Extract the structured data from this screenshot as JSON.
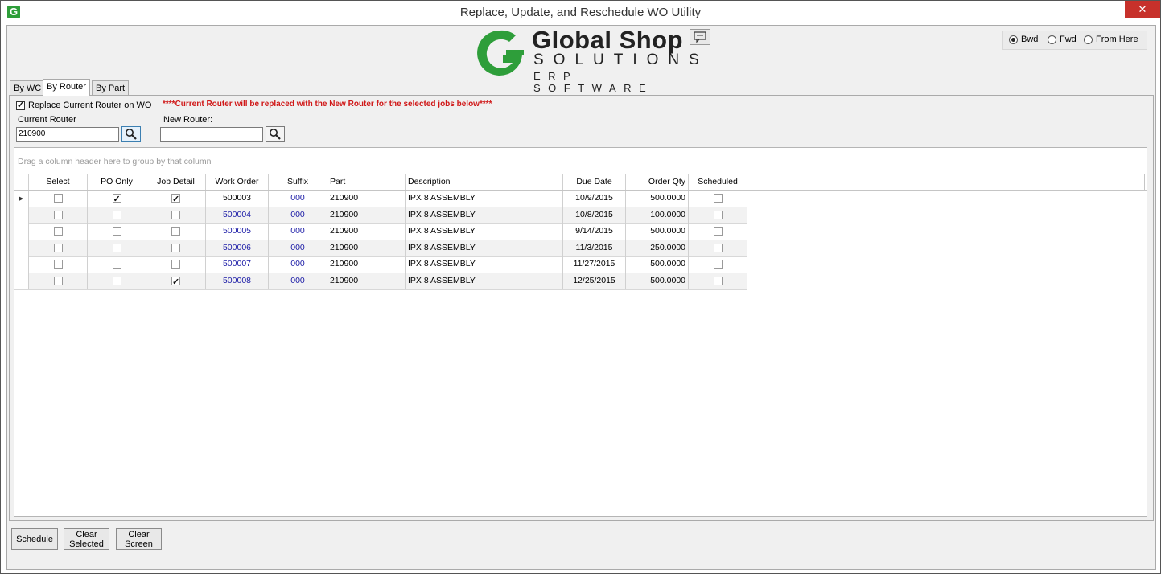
{
  "window": {
    "title": "Replace, Update, and Reschedule WO Utility",
    "minimize": "—",
    "maximize": "▢",
    "close": "✕"
  },
  "logo": {
    "line1": "Global Shop",
    "line2": "SOLUTIONS",
    "line3": "ERP SOFTWARE"
  },
  "schedule_direction": {
    "options": [
      {
        "label": "Bwd",
        "selected": true
      },
      {
        "label": "Fwd",
        "selected": false
      },
      {
        "label": "From Here",
        "selected": false
      }
    ]
  },
  "tabs": [
    {
      "label": "By WC",
      "active": false
    },
    {
      "label": "By Router",
      "active": true
    },
    {
      "label": "By Part",
      "active": false
    }
  ],
  "router_panel": {
    "replace_label": "Replace Current Router on WO",
    "replace_checked": true,
    "warning": "****Current Router will be replaced with the New Router for the selected jobs below****",
    "current_router_label": "Current Router",
    "current_router_value": "210900",
    "new_router_label": "New Router:",
    "new_router_value": ""
  },
  "grid": {
    "group_hint": "Drag a column header here to group by that column",
    "columns": [
      "Select",
      "PO Only",
      "Job Detail",
      "Work Order",
      "Suffix",
      "Part",
      "Description",
      "Due Date",
      "Order Qty",
      "Scheduled"
    ],
    "rows": [
      {
        "select": false,
        "po_only": true,
        "job_detail": true,
        "work_order": "500003",
        "suffix": "000",
        "part": "210900",
        "description": "IPX 8 ASSEMBLY",
        "due_date": "10/9/2015",
        "order_qty": "500.0000",
        "scheduled": false,
        "current": true
      },
      {
        "select": false,
        "po_only": false,
        "job_detail": false,
        "work_order": "500004",
        "suffix": "000",
        "part": "210900",
        "description": "IPX 8 ASSEMBLY",
        "due_date": "10/8/2015",
        "order_qty": "100.0000",
        "scheduled": false,
        "current": false
      },
      {
        "select": false,
        "po_only": false,
        "job_detail": false,
        "work_order": "500005",
        "suffix": "000",
        "part": "210900",
        "description": "IPX 8 ASSEMBLY",
        "due_date": "9/14/2015",
        "order_qty": "500.0000",
        "scheduled": false,
        "current": false
      },
      {
        "select": false,
        "po_only": false,
        "job_detail": false,
        "work_order": "500006",
        "suffix": "000",
        "part": "210900",
        "description": "IPX 8 ASSEMBLY",
        "due_date": "11/3/2015",
        "order_qty": "250.0000",
        "scheduled": false,
        "current": false
      },
      {
        "select": false,
        "po_only": false,
        "job_detail": false,
        "work_order": "500007",
        "suffix": "000",
        "part": "210900",
        "description": "IPX 8 ASSEMBLY",
        "due_date": "11/27/2015",
        "order_qty": "500.0000",
        "scheduled": false,
        "current": false
      },
      {
        "select": false,
        "po_only": false,
        "job_detail": true,
        "work_order": "500008",
        "suffix": "000",
        "part": "210900",
        "description": "IPX 8 ASSEMBLY",
        "due_date": "12/25/2015",
        "order_qty": "500.0000",
        "scheduled": false,
        "current": false
      }
    ]
  },
  "buttons": {
    "schedule": "Schedule",
    "clear_selected_1": "Clear",
    "clear_selected_2": "Selected",
    "clear_screen_1": "Clear",
    "clear_screen_2": "Screen"
  },
  "colors": {
    "warning": "#d01818",
    "link_blue": "#1a1aa6",
    "brand_green": "#2e9e3a"
  }
}
